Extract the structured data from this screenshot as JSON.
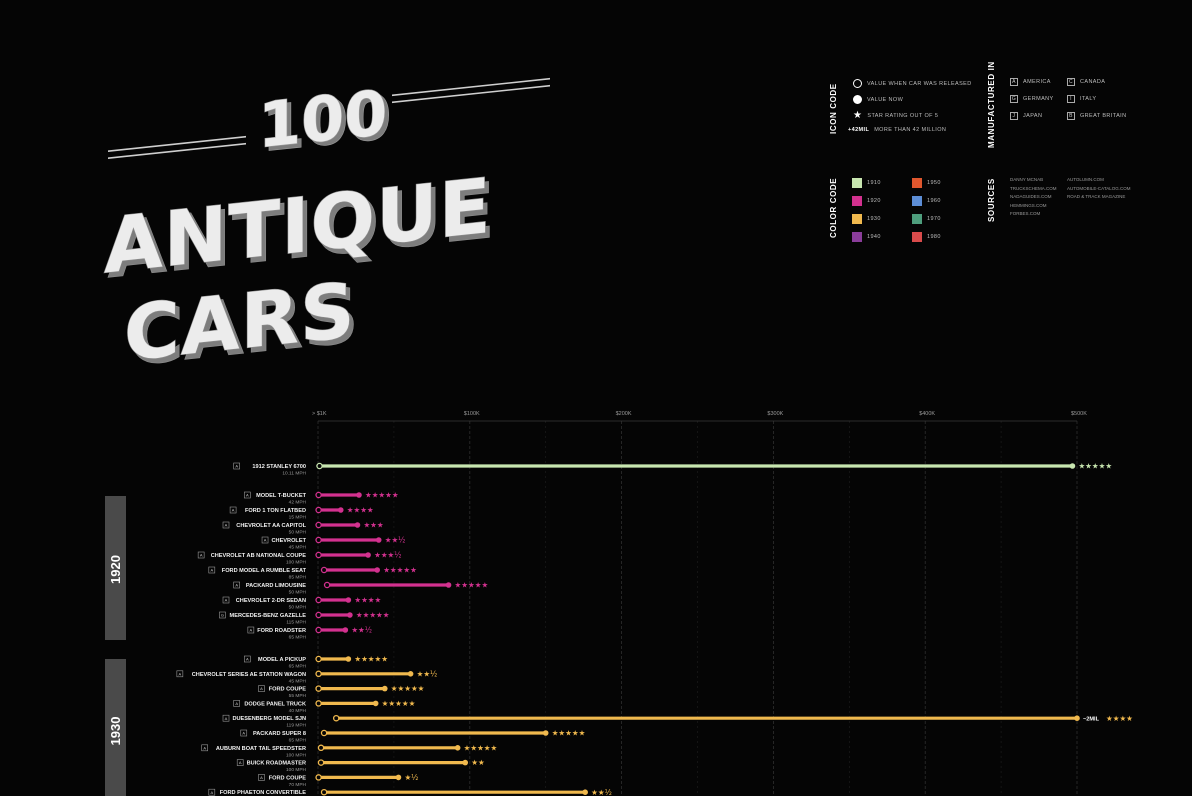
{
  "title": {
    "number": "100",
    "line1": "ANTIQUE",
    "line2": "CARS"
  },
  "legend": {
    "icon_code": {
      "heading": "ICON CODE",
      "items": [
        {
          "icon": "open-circle-icon",
          "text": "VALUE WHEN CAR WAS RELEASED"
        },
        {
          "icon": "filled-circle-icon",
          "text": "VALUE NOW"
        },
        {
          "icon": "star-icon",
          "text": "STAR RATING OUT OF 5"
        },
        {
          "icon": "text",
          "mark": "+42MIL",
          "text": "MORE THAN 42 MILLION"
        }
      ]
    },
    "manufactured_in": {
      "heading": "MANUFACTURED IN",
      "items": [
        {
          "code": "A",
          "text": "AMERICA"
        },
        {
          "code": "C",
          "text": "CANADA"
        },
        {
          "code": "G",
          "text": "GERMANY"
        },
        {
          "code": "I",
          "text": "ITALY"
        },
        {
          "code": "J",
          "text": "JAPAN"
        },
        {
          "code": "B",
          "text": "GREAT BRITAIN"
        }
      ]
    },
    "color_code": {
      "heading": "COLOR CODE",
      "items": [
        {
          "decade": "1910",
          "color": "#c8e6b0"
        },
        {
          "decade": "1950",
          "color": "#e0572e"
        },
        {
          "decade": "1920",
          "color": "#d3318f"
        },
        {
          "decade": "1960",
          "color": "#5d8ed6"
        },
        {
          "decade": "1930",
          "color": "#f0b94e"
        },
        {
          "decade": "1970",
          "color": "#4e9e7d"
        },
        {
          "decade": "1940",
          "color": "#8a3d9a"
        },
        {
          "decade": "1980",
          "color": "#d94b4b"
        }
      ]
    },
    "sources": {
      "heading": "SOURCES",
      "col1": [
        "DANNY MCNAB",
        "TRUCKSCHEMA.COM",
        "NADAGUIDES.COM",
        "HEMMINGS.COM",
        "FORBES.COM"
      ],
      "col2": [
        "AUTOLUMN.COM",
        "AUTOMOBILE-CATALOG.COM",
        "ROAD & TRACK MAGAZINE"
      ]
    }
  },
  "chart_data": {
    "type": "bar",
    "x_axis": {
      "ticks": [
        "> $1K",
        "$100K",
        "$200K",
        "$300K",
        "$400K",
        "$500K"
      ],
      "range": [
        0,
        500000
      ]
    },
    "groups": [
      {
        "decade": "",
        "color": "#c8e6b0",
        "cars": [
          {
            "country": "A",
            "name": "1912 STANLEY 6700",
            "speed": "10.11 MPH",
            "release": 1000,
            "now": 497000,
            "stars": "★★★★★",
            "note": ""
          }
        ]
      },
      {
        "decade": "1920",
        "color": "#d3318f",
        "cars": [
          {
            "country": "A",
            "name": "MODEL T-BUCKET",
            "speed": "42 MPH",
            "release": 400,
            "now": 27000,
            "stars": "★★★★★",
            "note": ""
          },
          {
            "country": "A",
            "name": "FORD 1 TON FLATBED",
            "speed": "15 MPH",
            "release": 400,
            "now": 15000,
            "stars": "★★★★",
            "note": ""
          },
          {
            "country": "A",
            "name": "CHEVROLET AA CAPITOL",
            "speed": "50 MPH",
            "release": 400,
            "now": 26000,
            "stars": "★★★",
            "note": ""
          },
          {
            "country": "A",
            "name": "CHEVROLET",
            "speed": "45 MPH",
            "release": 400,
            "now": 40000,
            "stars": "★★½",
            "note": ""
          },
          {
            "country": "A",
            "name": "CHEVROLET AB NATIONAL COUPE",
            "speed": "100 MPH",
            "release": 400,
            "now": 33000,
            "stars": "★★★½",
            "note": ""
          },
          {
            "country": "A",
            "name": "FORD MODEL A RUMBLE SEAT",
            "speed": "85 MPH",
            "release": 4000,
            "now": 39000,
            "stars": "★★★★★",
            "note": ""
          },
          {
            "country": "A",
            "name": "PACKARD LIMOUSINE",
            "speed": "50 MPH",
            "release": 6000,
            "now": 86000,
            "stars": "★★★★★",
            "note": ""
          },
          {
            "country": "A",
            "name": "CHEVROLET 2-DR SEDAN",
            "speed": "50 MPH",
            "release": 400,
            "now": 20000,
            "stars": "★★★★",
            "note": ""
          },
          {
            "country": "G",
            "name": "MERCEDES-BENZ GAZELLE",
            "speed": "115 MPH",
            "release": 400,
            "now": 21000,
            "stars": "★★★★★",
            "note": ""
          },
          {
            "country": "A",
            "name": "FORD ROADSTER",
            "speed": "65 MPH",
            "release": 400,
            "now": 18000,
            "stars": "★★½",
            "note": ""
          }
        ]
      },
      {
        "decade": "1930",
        "color": "#f0b94e",
        "cars": [
          {
            "country": "A",
            "name": "MODEL A PICKUP",
            "speed": "65 MPH",
            "release": 400,
            "now": 20000,
            "stars": "★★★★★",
            "note": ""
          },
          {
            "country": "A",
            "name": "CHEVROLET SERIES AE STATION WAGON",
            "speed": "45 MPH",
            "release": 400,
            "now": 61000,
            "stars": "★★½",
            "note": ""
          },
          {
            "country": "A",
            "name": "FORD COUPE",
            "speed": "55 MPH",
            "release": 400,
            "now": 44000,
            "stars": "★★★★★",
            "note": ""
          },
          {
            "country": "A",
            "name": "DODGE PANEL TRUCK",
            "speed": "40 MPH",
            "release": 400,
            "now": 38000,
            "stars": "★★★★★",
            "note": ""
          },
          {
            "country": "A",
            "name": "DUESENBERG MODEL SJN",
            "speed": "119 MPH",
            "release": 12000,
            "now": 500000,
            "stars": "★★★★",
            "note": "~2MIL"
          },
          {
            "country": "A",
            "name": "PACKARD SUPER 8",
            "speed": "65 MPH",
            "release": 4000,
            "now": 150000,
            "stars": "★★★★★",
            "note": ""
          },
          {
            "country": "A",
            "name": "AUBURN BOAT TAIL SPEEDSTER",
            "speed": "100 MPH",
            "release": 2000,
            "now": 92000,
            "stars": "★★★★★",
            "note": ""
          },
          {
            "country": "A",
            "name": "BUICK ROADMASTER",
            "speed": "100 MPH",
            "release": 2000,
            "now": 97000,
            "stars": "★★",
            "note": ""
          },
          {
            "country": "A",
            "name": "FORD COUPE",
            "speed": "70 MPH",
            "release": 400,
            "now": 53000,
            "stars": "★½",
            "note": ""
          },
          {
            "country": "A",
            "name": "FORD PHAETON CONVERTIBLE",
            "speed": "",
            "release": 4000,
            "now": 176000,
            "stars": "★★½",
            "note": ""
          }
        ]
      }
    ]
  }
}
